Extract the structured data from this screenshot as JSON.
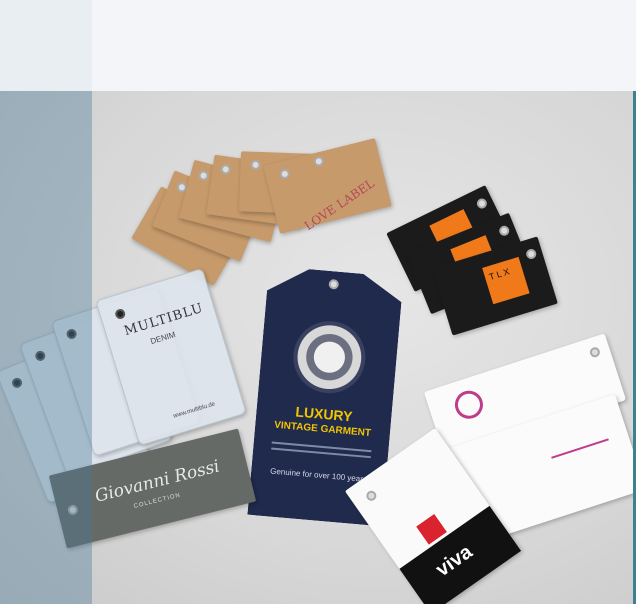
{
  "photo": {
    "kraft_label_text": "LOVE LABEL",
    "clear_tag_text": "MULTIBLU",
    "clear_tag_subtext": "DENIM",
    "clear_tag_url": "www.multiblu.de",
    "navy_tag_title": "LUXURY",
    "navy_tag_subtitle": "VINTAGE GARMENT",
    "navy_tag_footer": "Genuine for over 100 years",
    "orange_tag_text": "T L X",
    "gray_tag_text": "Giovanni Rossi",
    "gray_tag_subtext": "COLLECTION",
    "white_tag_text": "viva"
  }
}
